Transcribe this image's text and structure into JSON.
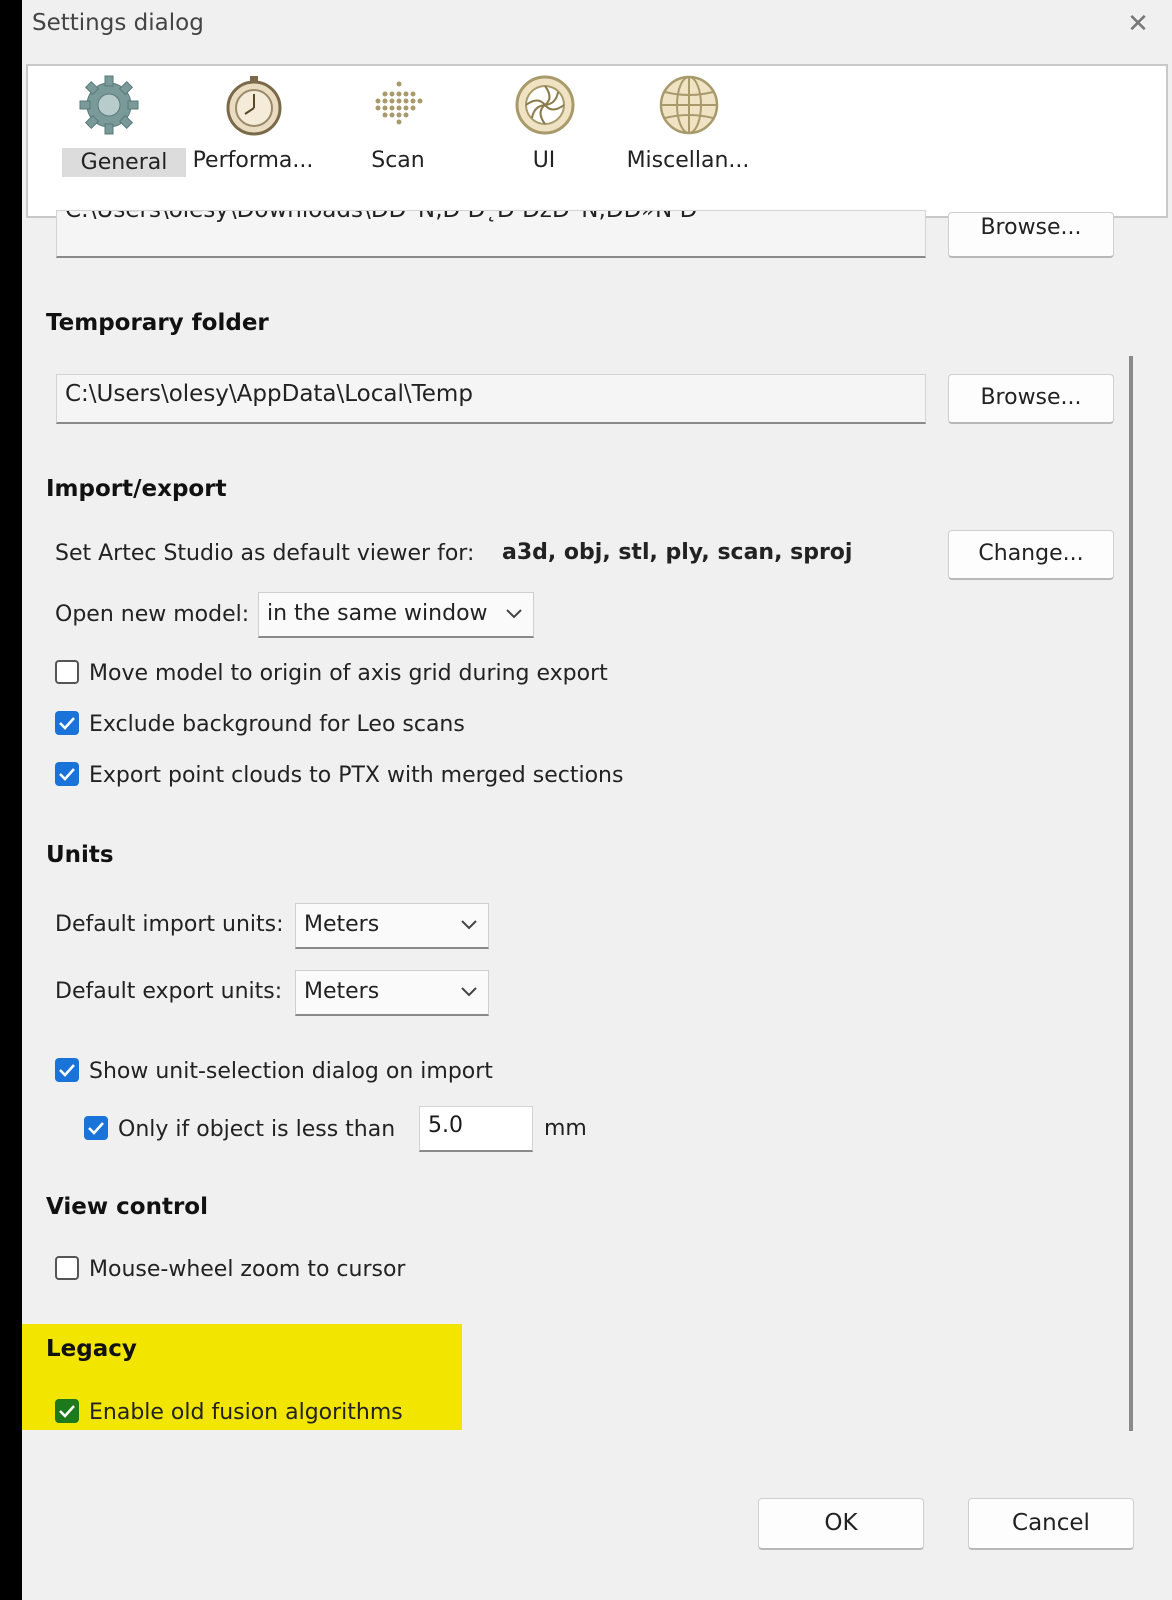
{
  "window": {
    "title": "Settings dialog",
    "close_symbol": "✕"
  },
  "tabs": [
    {
      "label": "General",
      "icon": "gear-icon",
      "active": true
    },
    {
      "label": "Performa...",
      "icon": "stopwatch-icon",
      "active": false
    },
    {
      "label": "Scan",
      "icon": "dot-grid-icon",
      "active": false
    },
    {
      "label": "UI",
      "icon": "aperture-icon",
      "active": false
    },
    {
      "label": "Miscellan...",
      "icon": "globe-icon",
      "active": false
    }
  ],
  "top_path": {
    "value": "C:\\Users\\olesy\\Downloads\\ĐĐ¨Ń‚Đ Đ˛Đ ĐžĐ¨Ń‚ĐĐ»Ń Đ",
    "browse_label": "Browse..."
  },
  "temporary_folder": {
    "heading": "Temporary folder",
    "value": "C:\\Users\\olesy\\AppData\\Local\\Temp",
    "browse_label": "Browse..."
  },
  "import_export": {
    "heading": "Import/export",
    "default_viewer_label": "Set Artec Studio as default viewer for:",
    "default_viewer_formats": "a3d, obj, stl, ply, scan, sproj",
    "change_label": "Change...",
    "open_new_model_label": "Open new model:",
    "open_new_model_value": "in the same window",
    "options": [
      {
        "label": "Move model to origin of axis grid during export",
        "checked": false
      },
      {
        "label": "Exclude background for Leo scans",
        "checked": true
      },
      {
        "label": "Export point clouds to PTX with merged sections",
        "checked": true
      }
    ]
  },
  "units": {
    "heading": "Units",
    "import_label": "Default import units:",
    "import_value": "Meters",
    "export_label": "Default export units:",
    "export_value": "Meters",
    "show_dialog_label": "Show unit-selection dialog on import",
    "show_dialog_checked": true,
    "only_if_label": "Only if object is less than",
    "only_if_checked": true,
    "threshold_value": "5.0",
    "threshold_unit": "mm"
  },
  "view_control": {
    "heading": "View control",
    "mouse_wheel_label": "Mouse-wheel zoom to cursor",
    "mouse_wheel_checked": false
  },
  "legacy": {
    "heading": "Legacy",
    "old_fusion_label": "Enable old fusion algorithms",
    "old_fusion_checked": true,
    "highlight_color": "#f2e600"
  },
  "footer": {
    "ok_label": "OK",
    "cancel_label": "Cancel"
  },
  "colors": {
    "checkbox_accent": "#1a73d9",
    "checkbox_legacy": "#1c7a1c"
  }
}
